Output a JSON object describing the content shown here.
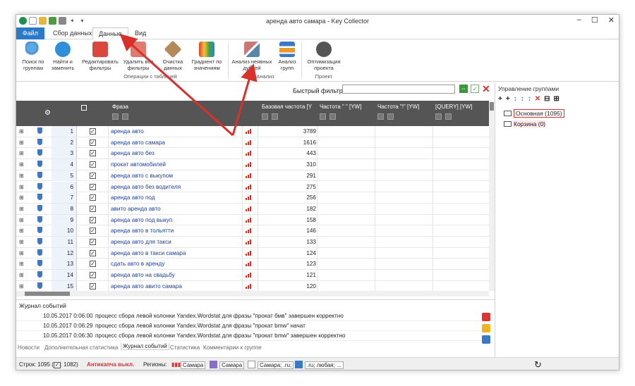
{
  "window": {
    "title": "аренда авто самара - Key Collector"
  },
  "tabs": [
    {
      "label": "Файл"
    },
    {
      "label": "Сбор данных"
    },
    {
      "label": "Данные"
    },
    {
      "label": "Вид"
    }
  ],
  "ribbon": {
    "buttons": [
      {
        "label": "Поиск по группам"
      },
      {
        "label": "Найти и заменить"
      },
      {
        "label": "Редактировать фильтры"
      },
      {
        "label": "Удалить все фильтры"
      },
      {
        "label": "Очистка данных"
      },
      {
        "label": "Градиент по значениям"
      },
      {
        "label": "Анализ неявных дублей"
      },
      {
        "label": "Анализ групп"
      },
      {
        "label": "Оптимизация проекта"
      }
    ],
    "groups": {
      "table": "Операции с таблицей",
      "analysis": "Анализ",
      "project": "Проект"
    }
  },
  "filter": {
    "label": "Быстрый фильтр:",
    "value": ""
  },
  "grid": {
    "columns": [
      "Фраза",
      "Базовая частота [Y",
      "Частота \" \" [YW]",
      "Частота \"!\" [YW]",
      "[QUERY] [YW]"
    ],
    "rows": [
      {
        "n": "1",
        "phrase": "аренда авто",
        "freq": "3789"
      },
      {
        "n": "2",
        "phrase": "аренда авто самара",
        "freq": "1616"
      },
      {
        "n": "3",
        "phrase": "аренда авто без",
        "freq": "443"
      },
      {
        "n": "4",
        "phrase": "прокат автомобилей",
        "freq": "310"
      },
      {
        "n": "5",
        "phrase": "аренда авто с выкупом",
        "freq": "291"
      },
      {
        "n": "6",
        "phrase": "аренда авто без водителя",
        "freq": "275"
      },
      {
        "n": "7",
        "phrase": "аренда авто под",
        "freq": "256"
      },
      {
        "n": "8",
        "phrase": "авито аренда авто",
        "freq": "182"
      },
      {
        "n": "9",
        "phrase": "аренда авто под выкуп",
        "freq": "158"
      },
      {
        "n": "10",
        "phrase": "аренда авто в тольятти",
        "freq": "146"
      },
      {
        "n": "11",
        "phrase": "аренда авто для такси",
        "freq": "133"
      },
      {
        "n": "12",
        "phrase": "аренда авто в такси самара",
        "freq": "124"
      },
      {
        "n": "13",
        "phrase": "сдать авто в аренду",
        "freq": "123"
      },
      {
        "n": "14",
        "phrase": "аренда авто на свадьбу",
        "freq": "121"
      },
      {
        "n": "15",
        "phrase": "аренда авто авито самара",
        "freq": "120"
      }
    ]
  },
  "groups_panel": {
    "title": "Управление группами",
    "items": [
      {
        "label": "Основная (1095)"
      },
      {
        "label": "Корзина (0)"
      }
    ]
  },
  "journal": {
    "title": "Журнал событий",
    "rows": [
      {
        "time": "10.05.2017 0:06:00",
        "text": "процесс сбора левой колонки Yandex.Wordstat для фразы \"прокат бмв\" завершен корректно"
      },
      {
        "time": "10.05.2017 0:06:29",
        "text": "процесс сбора левой колонки Yandex.Wordstat для фразы \"прокат bmw\" начат"
      },
      {
        "time": "10.05.2017 0:06:30",
        "text": "процесс сбора левой колонки Yandex.Wordstat для фразы \"прокат bmw\" завершен корректно"
      }
    ]
  },
  "bottom_tabs": [
    "Новости",
    "Дополнительная статистика",
    "Журнал событий",
    "Статистика",
    "Комментарии к группе"
  ],
  "status": {
    "rows": "Строк: 1095 (",
    "checked": ": 1082)",
    "anticaptcha": "Антикапча выкл.",
    "regions": "Регионы:",
    "r1": "Самара",
    "r2": "Самара",
    "r3": "Самара; .ru;",
    "r4": ".ru; любая; ..."
  },
  "colors": {
    "accent": "#2b79c9",
    "header": "#555555",
    "arrow": "#d9302c"
  }
}
